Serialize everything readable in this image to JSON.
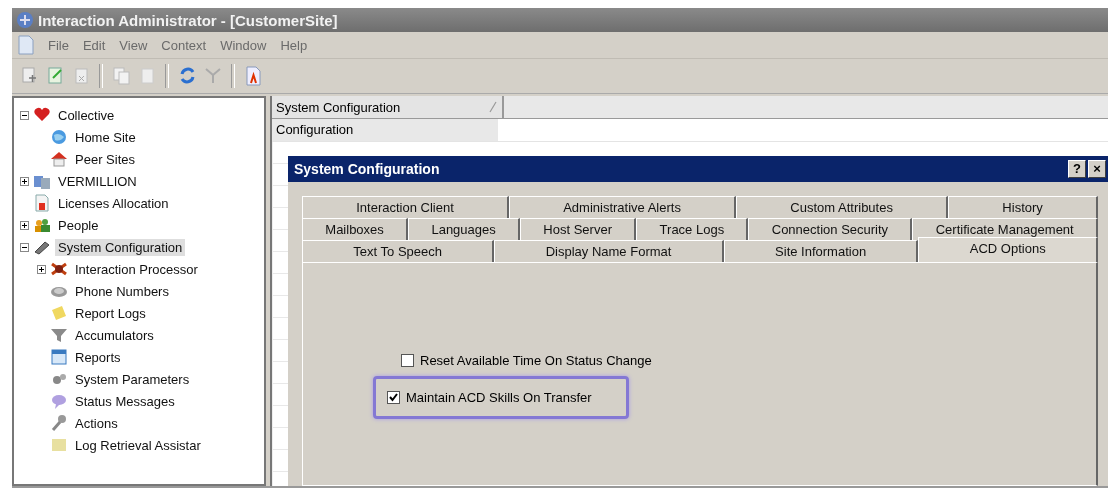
{
  "window": {
    "title": "Interaction Administrator - [CustomerSite]"
  },
  "menu": [
    "File",
    "Edit",
    "View",
    "Context",
    "Window",
    "Help"
  ],
  "tree": [
    {
      "label": "Collective",
      "expanded": true,
      "selected": false,
      "children": [
        {
          "label": "Home Site",
          "selected": false
        },
        {
          "label": "Peer Sites",
          "selected": false
        }
      ]
    },
    {
      "label": "VERMILLION",
      "expanded": false,
      "selected": false
    },
    {
      "label": "Licenses Allocation",
      "selected": false
    },
    {
      "label": "People",
      "expanded": false,
      "selected": false
    },
    {
      "label": "System Configuration",
      "expanded": true,
      "selected": true,
      "children": [
        {
          "label": "Interaction Processor",
          "expanded": false,
          "selected": false
        },
        {
          "label": "Phone Numbers",
          "selected": false
        },
        {
          "label": "Report Logs",
          "selected": false
        },
        {
          "label": "Accumulators",
          "selected": false
        },
        {
          "label": "Reports",
          "selected": false
        },
        {
          "label": "System Parameters",
          "selected": false
        },
        {
          "label": "Status Messages",
          "selected": false
        },
        {
          "label": "Actions",
          "selected": false
        },
        {
          "label": "Log Retrieval Assistar",
          "selected": false
        }
      ]
    }
  ],
  "list": {
    "column": "System Configuration",
    "rows": [
      "Configuration"
    ]
  },
  "dialog": {
    "title": "System Configuration",
    "buttons": [
      "?",
      "×"
    ],
    "tab_rows": [
      [
        {
          "label": "Interaction Client",
          "selected": false
        },
        {
          "label": "Administrative Alerts",
          "selected": false
        },
        {
          "label": "Custom Attributes",
          "selected": false
        },
        {
          "label": "History",
          "selected": false
        }
      ],
      [
        {
          "label": "Mailboxes",
          "selected": false
        },
        {
          "label": "Languages",
          "selected": false
        },
        {
          "label": "Host Server",
          "selected": false
        },
        {
          "label": "Trace Logs",
          "selected": false
        },
        {
          "label": "Connection Security",
          "selected": false
        },
        {
          "label": "Certificate Management",
          "selected": false
        }
      ],
      [
        {
          "label": "Text To Speech",
          "selected": false
        },
        {
          "label": "Display Name Format",
          "selected": false
        },
        {
          "label": "Site Information",
          "selected": false
        },
        {
          "label": "ACD Options",
          "selected": true
        }
      ]
    ],
    "options": [
      {
        "label": "Reset Available Time On Status Change",
        "checked": false,
        "highlighted": false
      },
      {
        "label": "Maintain ACD Skills On Transfer",
        "checked": true,
        "highlighted": true
      }
    ]
  }
}
